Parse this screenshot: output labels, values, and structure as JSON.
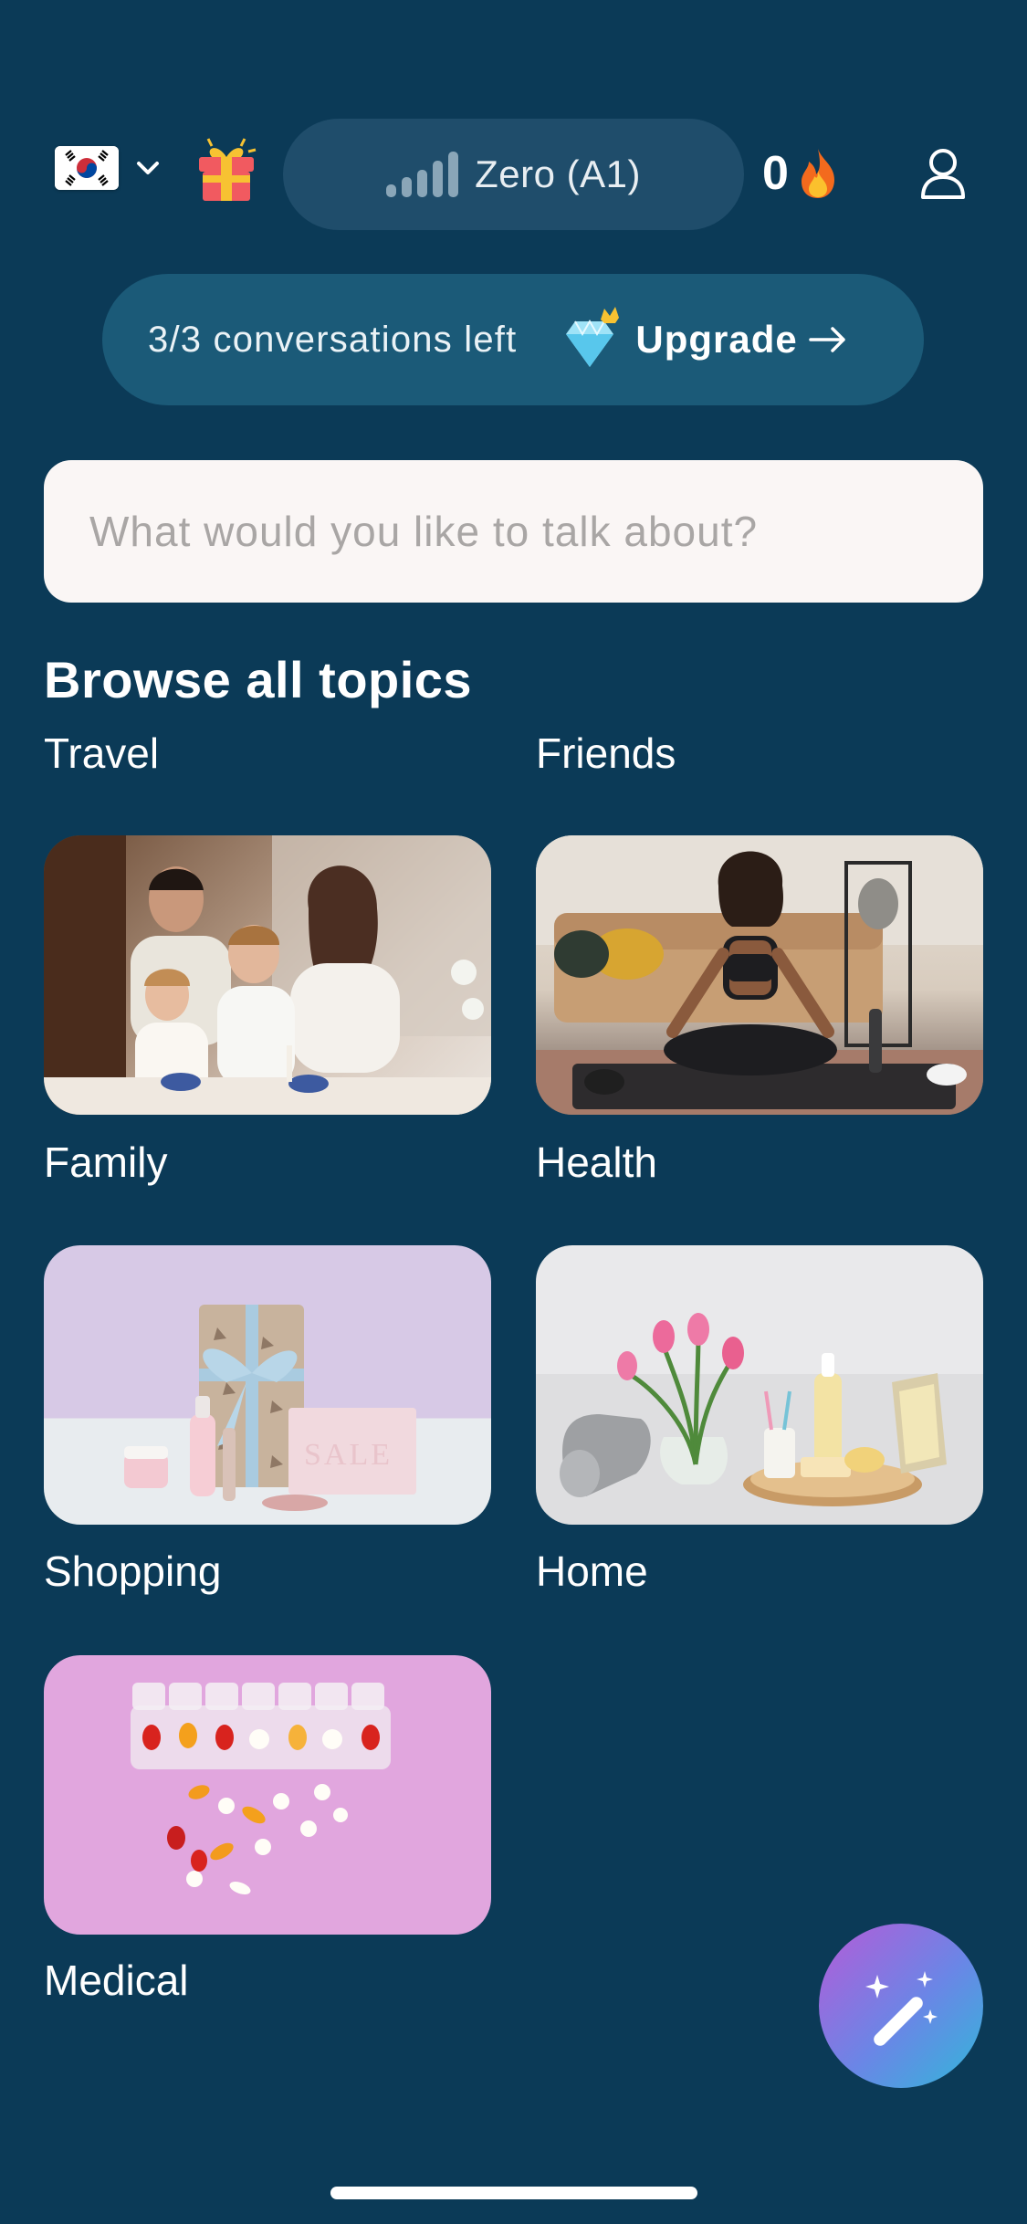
{
  "header": {
    "language_flag": "south-korea-flag",
    "level_label": "Zero (A1)",
    "streak_count": "0"
  },
  "banner": {
    "conversations_left": "3/3 conversations left",
    "upgrade_label": "Upgrade"
  },
  "search": {
    "placeholder": "What would you like to talk about?"
  },
  "topics": {
    "section_title": "Browse all topics",
    "items": [
      {
        "label": "Travel"
      },
      {
        "label": "Friends"
      },
      {
        "label": "Family"
      },
      {
        "label": "Health"
      },
      {
        "label": "Shopping"
      },
      {
        "label": "Home"
      },
      {
        "label": "Medical"
      }
    ]
  },
  "colors": {
    "background": "#0b3a57",
    "pill": "#1f4d6b",
    "banner": "#1b5a78",
    "search_bg": "#faf6f5"
  }
}
